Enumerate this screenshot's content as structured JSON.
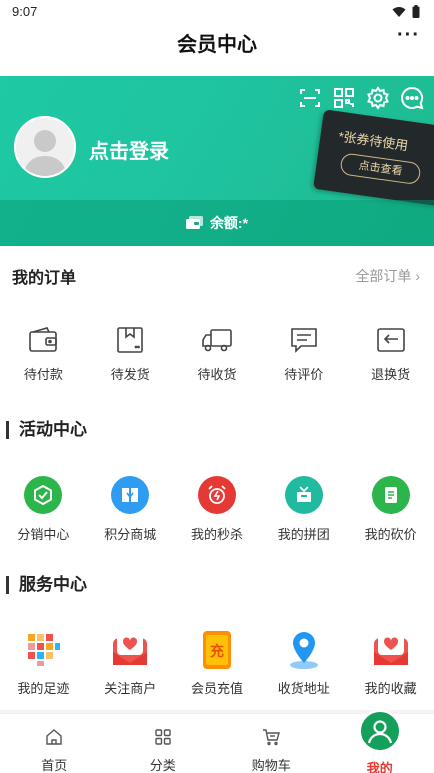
{
  "status": {
    "time": "9:07"
  },
  "header": {
    "title": "会员中心",
    "more": "···"
  },
  "hero": {
    "login_text": "点击登录",
    "coupon_title": "*张券待使用",
    "coupon_button": "点击查看",
    "balance_text": "余额:*"
  },
  "orders": {
    "title": "我的订单",
    "all_link": "全部订单 ›",
    "items": [
      {
        "label": "待付款",
        "icon": "wallet-icon"
      },
      {
        "label": "待发货",
        "icon": "package-icon"
      },
      {
        "label": "待收货",
        "icon": "truck-icon"
      },
      {
        "label": "待评价",
        "icon": "comment-icon"
      },
      {
        "label": "退换货",
        "icon": "return-icon"
      }
    ]
  },
  "activity": {
    "title": "活动中心",
    "items": [
      {
        "label": "分销中心",
        "icon": "distribution-icon",
        "color": "#2bb54a"
      },
      {
        "label": "积分商城",
        "icon": "points-mall-icon",
        "color": "#2e9cf0"
      },
      {
        "label": "我的秒杀",
        "icon": "flash-sale-icon",
        "color": "#e53935"
      },
      {
        "label": "我的拼团",
        "icon": "group-buy-icon",
        "color": "#21b9a0"
      },
      {
        "label": "我的砍价",
        "icon": "bargain-icon",
        "color": "#2bb54a"
      }
    ]
  },
  "services": {
    "title": "服务中心",
    "items": [
      {
        "label": "我的足迹",
        "icon": "footprint-icon"
      },
      {
        "label": "关注商户",
        "icon": "follow-shop-icon"
      },
      {
        "label": "会员充值",
        "icon": "recharge-icon"
      },
      {
        "label": "收货地址",
        "icon": "address-icon"
      },
      {
        "label": "我的收藏",
        "icon": "favorites-icon"
      }
    ],
    "recharge_glyph": "充"
  },
  "tabbar": {
    "items": [
      {
        "label": "首页",
        "icon": "home-icon"
      },
      {
        "label": "分类",
        "icon": "category-icon"
      },
      {
        "label": "购物车",
        "icon": "cart-icon"
      },
      {
        "label": "我的",
        "icon": "user-icon",
        "active": true
      }
    ]
  },
  "colors": {
    "brand": "#1ec9a3",
    "active_tab": "#e53935",
    "tab_circle": "#14a05a"
  }
}
